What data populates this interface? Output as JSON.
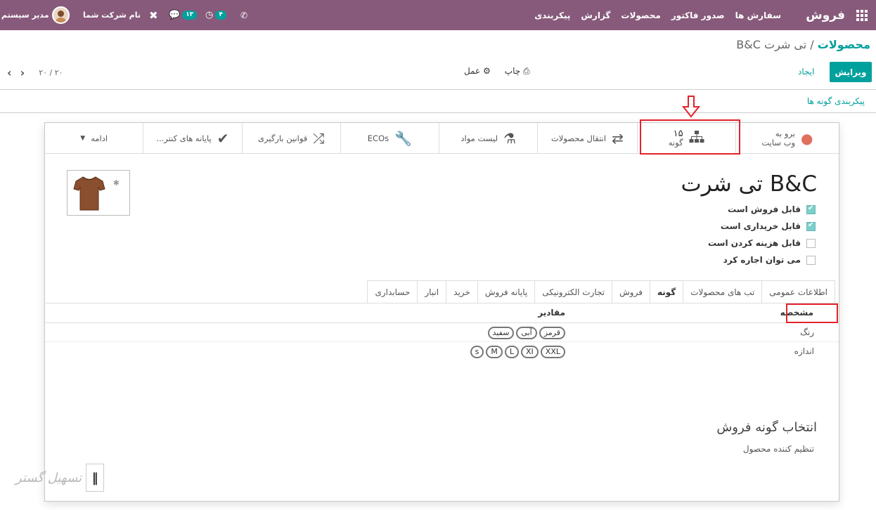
{
  "topbar": {
    "brand": "فروش",
    "menu": [
      "سفارش ها",
      "صدور فاکتور",
      "محصولات",
      "گزارش",
      "پیکربندی"
    ],
    "user": "مدیر سیستم",
    "company": "نام شرکت شما",
    "messages_count": "۱۳",
    "activities_count": "۴"
  },
  "breadcrumb": {
    "parent": "محصولات",
    "separator": "/",
    "current": "تی شرت B&C"
  },
  "actions": {
    "edit": "ویرایش",
    "create": "ایجاد",
    "print": "چاپ",
    "action": "عمل"
  },
  "pager": {
    "value": "۲۰ / ۲۰"
  },
  "variants_link": "پیکربندی گونه ها",
  "smart_buttons": {
    "website_line1": "برو به",
    "website_line2": "وب سایت",
    "variants_count": "۱۵",
    "variants_label": "گونه",
    "moves": "انتقال محصولات",
    "bom": "لیست مواد",
    "eco": "ECOs",
    "putaway": "قوانین بارگیری",
    "reordering": "پایانه های کنتر...",
    "more": "ادامه"
  },
  "product": {
    "name": "تی شرت B&C",
    "checks": [
      {
        "label": "قابل فروش است",
        "checked": true
      },
      {
        "label": "قابل خریداری است",
        "checked": true
      },
      {
        "label": "قابل هزینه کردن است",
        "checked": false
      },
      {
        "label": "می توان اجاره کرد",
        "checked": false
      }
    ]
  },
  "tabs": [
    "اطلاعات عمومی",
    "تب های محصولات",
    "گونه",
    "فروش",
    "تجارت الکترونیکی",
    "پایانه فروش",
    "خرید",
    "انبار",
    "حسابداری"
  ],
  "attributes_table": {
    "headers": [
      "مشخصه",
      "مقادیر"
    ],
    "rows": [
      {
        "attribute": "رنگ",
        "values": [
          "سفید",
          "آبی",
          "قرمز"
        ]
      },
      {
        "attribute": "اندازه",
        "values": [
          "s",
          "M",
          "L",
          "XI",
          "XXL"
        ]
      }
    ]
  },
  "section": {
    "title": "انتخاب گونه فروش",
    "subtitle": "تنظیم کننده محصول"
  },
  "watermark": "تسهیل گستر",
  "colors": {
    "topbar": "#875a7b",
    "accent": "#00a09d",
    "highlight": "#e3232c"
  }
}
